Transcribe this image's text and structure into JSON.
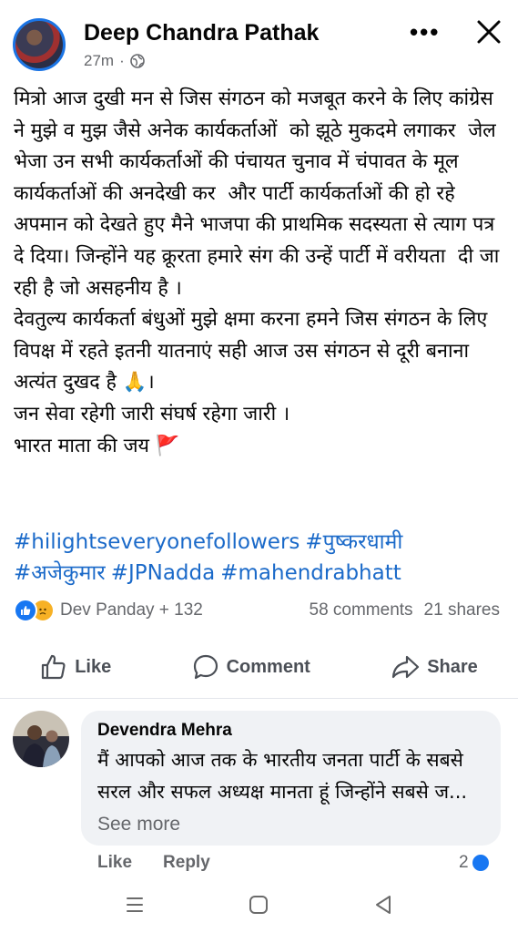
{
  "post": {
    "author": "Deep Chandra Pathak",
    "time": "27m",
    "privacy_icon": "globe-icon",
    "body": "मित्रो आज दुखी मन से जिस संगठन को मजबूत करने के लिए कांग्रेस ने मुझे व मुझ जैसे अनेक कार्यकर्ताओं  को झूठे मुकदमे लगाकर  जेल भेजा उन सभी कार्यकर्ताओं की पंचायत चुनाव में चंपावत के मूल कार्यकर्ताओं की अनदेखी कर  और पार्टी कार्यकर्ताओं की हो रहे अपमान को देखते हुए मैने भाजपा की प्राथमिक सदस्यता से त्याग पत्र दे दिया। जिन्होंने यह क्रूरता हमारे संग की उन्हें पार्टी में वरीयता  दी जा रही है जो असहनीय है ।\nदेवतुल्य कार्यकर्ता बंधुओं मुझे क्षमा करना हमने जिस संगठन के लिए विपक्ष में रहते इतनी यातनाएं सही आज उस संगठन से दूरी बनाना अत्यंत दुखद है 🙏।\nजन सेवा रहेगी जारी संघर्ष रहेगा जारी ।\nभारत माता की जय 🚩",
    "hashtags": [
      "#hilightseveryonefollowers",
      "#पुष्करधामी",
      "#अजेकुमार",
      "#JPNadda",
      "#mahendrabhatt"
    ],
    "reactions_text": "Dev Panday + 132",
    "comments_count": "58 comments",
    "shares_count": "21 shares"
  },
  "actions": {
    "like": "Like",
    "comment": "Comment",
    "share": "Share"
  },
  "comment": {
    "author": "Devendra Mehra",
    "text": "मैं आपको आज तक के भारतीय जनता पार्टी के सबसे सरल और सफल अध्यक्ष मानता हूं जिन्होंने सबसे ज...",
    "see_more": "See more",
    "like": "Like",
    "reply": "Reply",
    "reaction_count": "2"
  },
  "colors": {
    "link": "#1b6ac9",
    "like_blue": "#1877f2",
    "muted": "#65676b",
    "bubble": "#f0f2f5"
  }
}
